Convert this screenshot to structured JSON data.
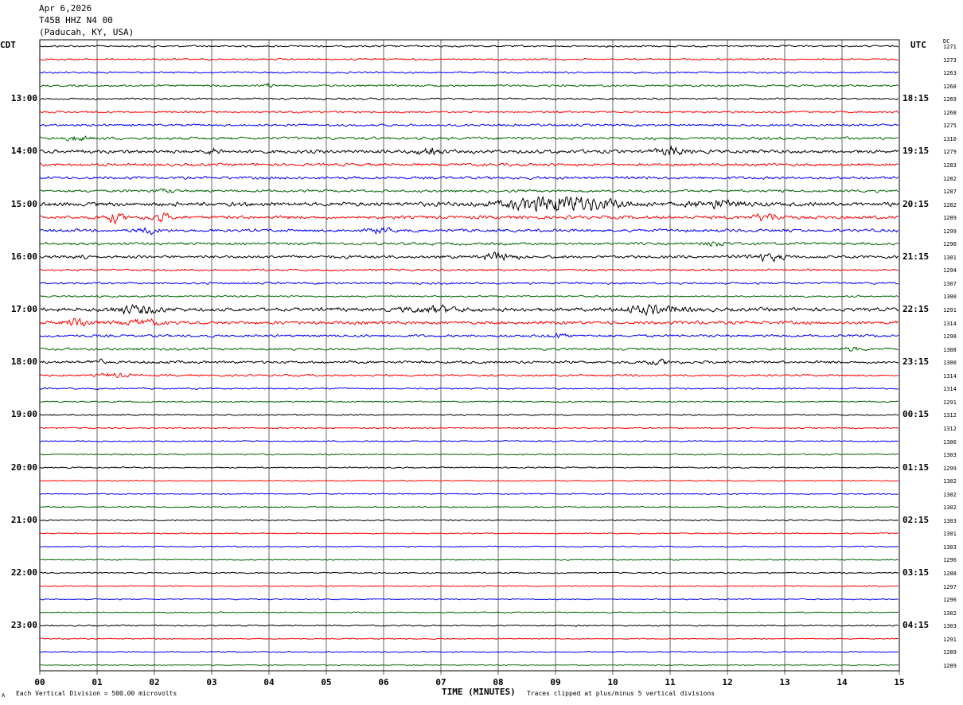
{
  "header": {
    "date": "Apr 6,2026",
    "station": "T45B HHZ N4 00",
    "location": "(Paducah, KY, USA)"
  },
  "axes": {
    "left_timezone": "CDT",
    "right_timezone": "UTC",
    "dc_label": "DC",
    "xlabel": "TIME (MINUTES)",
    "scale_note": "Each Vertical Division =  500.00 microvolts",
    "clip_note": "Traces clipped at plus/minus 5 vertical divisions",
    "corner_mark": "A"
  },
  "colors": {
    "trace_cycle": [
      "#000000",
      "#ff0000",
      "#0000ff",
      "#006400"
    ],
    "grid": "#000000"
  },
  "chart_data": {
    "type": "line",
    "title": "",
    "xlim": [
      0,
      15
    ],
    "x_ticks": [
      "00",
      "01",
      "02",
      "03",
      "04",
      "05",
      "06",
      "07",
      "08",
      "09",
      "10",
      "11",
      "12",
      "13",
      "14",
      "15"
    ],
    "rows": 48,
    "left_hour_labels": [
      {
        "row": 4,
        "label": "13:00"
      },
      {
        "row": 8,
        "label": "14:00"
      },
      {
        "row": 12,
        "label": "15:00"
      },
      {
        "row": 16,
        "label": "16:00"
      },
      {
        "row": 20,
        "label": "17:00"
      },
      {
        "row": 24,
        "label": "18:00"
      },
      {
        "row": 28,
        "label": "19:00"
      },
      {
        "row": 32,
        "label": "20:00"
      },
      {
        "row": 36,
        "label": "21:00"
      },
      {
        "row": 40,
        "label": "22:00"
      },
      {
        "row": 44,
        "label": "23:00"
      }
    ],
    "right_hour_labels": [
      {
        "row": 4,
        "label": "18:15"
      },
      {
        "row": 8,
        "label": "19:15"
      },
      {
        "row": 12,
        "label": "20:15"
      },
      {
        "row": 16,
        "label": "21:15"
      },
      {
        "row": 20,
        "label": "22:15"
      },
      {
        "row": 24,
        "label": "23:15"
      },
      {
        "row": 28,
        "label": "00:15"
      },
      {
        "row": 32,
        "label": "01:15"
      },
      {
        "row": 36,
        "label": "02:15"
      },
      {
        "row": 40,
        "label": "03:15"
      },
      {
        "row": 44,
        "label": "04:15"
      }
    ],
    "dc_values": [
      "1271",
      "1273",
      "1263",
      "1268",
      "1269",
      "1268",
      "1275",
      "1310",
      "1279",
      "1283",
      "1282",
      "1287",
      "1282",
      "1289",
      "1299",
      "1290",
      "1301",
      "1294",
      "1307",
      "1300",
      "1291",
      "1314",
      "1298",
      "1308",
      "1300",
      "1314",
      "1314",
      "1291",
      "1312",
      "1312",
      "1306",
      "1303",
      "1299",
      "1302",
      "1302",
      "1302",
      "1303",
      "1301",
      "1303",
      "1296",
      "1288",
      "1297",
      "1296",
      "1302",
      "1303",
      "1291",
      "1289",
      "1289"
    ],
    "row_amplitude": [
      0.5,
      0.45,
      0.45,
      0.55,
      0.5,
      0.55,
      0.6,
      0.75,
      0.95,
      0.75,
      0.75,
      0.7,
      1.1,
      0.9,
      0.8,
      0.7,
      0.8,
      0.55,
      0.55,
      0.45,
      1.0,
      0.9,
      0.7,
      0.65,
      0.75,
      0.55,
      0.4,
      0.35,
      0.4,
      0.35,
      0.35,
      0.35,
      0.35,
      0.3,
      0.3,
      0.3,
      0.35,
      0.3,
      0.3,
      0.3,
      0.35,
      0.3,
      0.3,
      0.3,
      0.35,
      0.3,
      0.3,
      0.3
    ],
    "bursts": [
      {
        "row": 3,
        "minute": 4.0,
        "width": 0.15,
        "gain": 1.5
      },
      {
        "row": 7,
        "minute": 0.6,
        "width": 0.3,
        "gain": 1.8
      },
      {
        "row": 8,
        "minute": 3.0,
        "width": 0.2,
        "gain": 2.0
      },
      {
        "row": 8,
        "minute": 6.8,
        "width": 0.3,
        "gain": 2.5
      },
      {
        "row": 8,
        "minute": 11.0,
        "width": 0.4,
        "gain": 2.0
      },
      {
        "row": 11,
        "minute": 2.2,
        "width": 0.3,
        "gain": 1.5
      },
      {
        "row": 12,
        "minute": 9.1,
        "width": 1.4,
        "gain": 4.0
      },
      {
        "row": 12,
        "minute": 11.8,
        "width": 0.6,
        "gain": 1.8
      },
      {
        "row": 13,
        "minute": 1.3,
        "width": 0.3,
        "gain": 2.5
      },
      {
        "row": 13,
        "minute": 2.1,
        "width": 0.3,
        "gain": 2.3
      },
      {
        "row": 13,
        "minute": 12.7,
        "width": 0.4,
        "gain": 2.0
      },
      {
        "row": 14,
        "minute": 1.9,
        "width": 0.3,
        "gain": 1.8
      },
      {
        "row": 14,
        "minute": 5.9,
        "width": 0.3,
        "gain": 1.8
      },
      {
        "row": 15,
        "minute": 11.8,
        "width": 0.3,
        "gain": 1.6
      },
      {
        "row": 16,
        "minute": 0.7,
        "width": 0.2,
        "gain": 1.8
      },
      {
        "row": 16,
        "minute": 8.0,
        "width": 0.5,
        "gain": 2.2
      },
      {
        "row": 16,
        "minute": 12.7,
        "width": 0.5,
        "gain": 2.2
      },
      {
        "row": 20,
        "minute": 1.7,
        "width": 0.7,
        "gain": 1.8
      },
      {
        "row": 20,
        "minute": 6.9,
        "width": 0.8,
        "gain": 1.6
      },
      {
        "row": 20,
        "minute": 10.7,
        "width": 0.9,
        "gain": 1.9
      },
      {
        "row": 21,
        "minute": 0.7,
        "width": 0.3,
        "gain": 2.5
      },
      {
        "row": 21,
        "minute": 1.8,
        "width": 0.5,
        "gain": 1.6
      },
      {
        "row": 22,
        "minute": 9.0,
        "width": 0.3,
        "gain": 1.5
      },
      {
        "row": 23,
        "minute": 14.2,
        "width": 0.3,
        "gain": 1.5
      },
      {
        "row": 24,
        "minute": 1.0,
        "width": 0.2,
        "gain": 1.8
      },
      {
        "row": 24,
        "minute": 10.8,
        "width": 0.4,
        "gain": 1.6
      },
      {
        "row": 25,
        "minute": 1.3,
        "width": 0.4,
        "gain": 1.7
      }
    ]
  }
}
